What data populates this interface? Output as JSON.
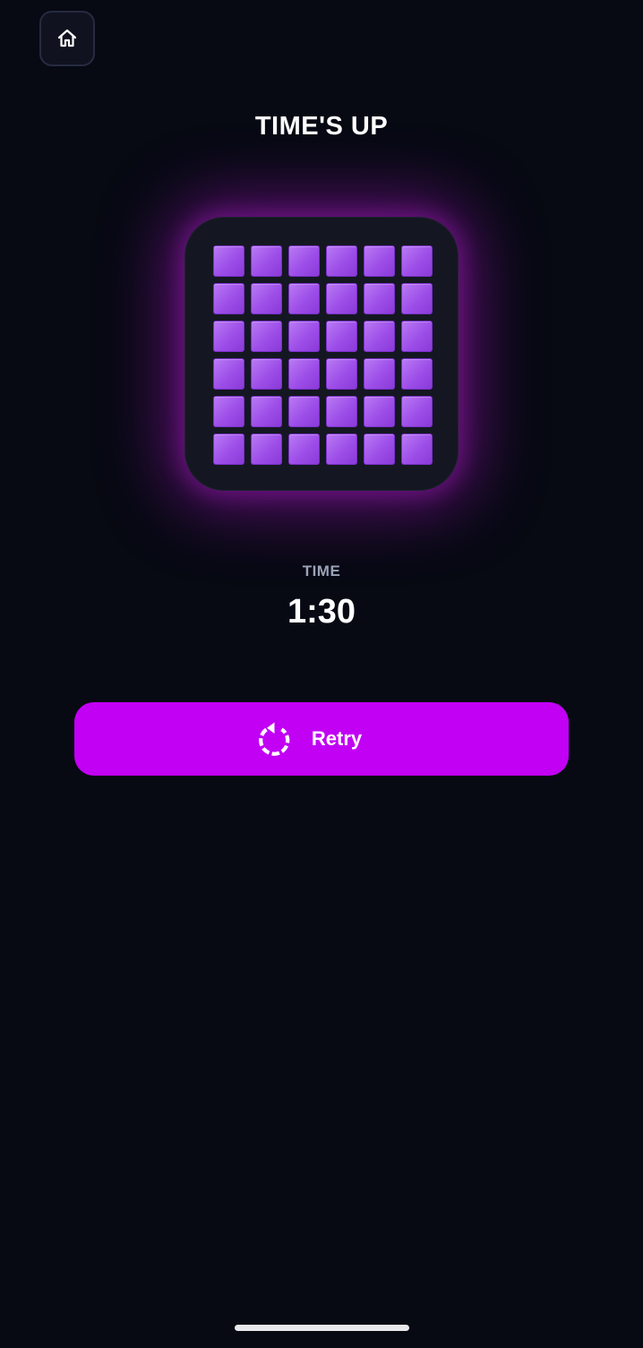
{
  "header": {
    "home_icon": "home-icon"
  },
  "result": {
    "title": "TIME'S UP"
  },
  "board": {
    "rows": 6,
    "cols": 6,
    "tile_color": "#a35af0",
    "glow_color": "#9614af"
  },
  "stats": {
    "time_label": "TIME",
    "time_value": "1:30"
  },
  "actions": {
    "retry_label": "Retry",
    "retry_icon": "retry-icon",
    "retry_color": "#c100f4"
  }
}
